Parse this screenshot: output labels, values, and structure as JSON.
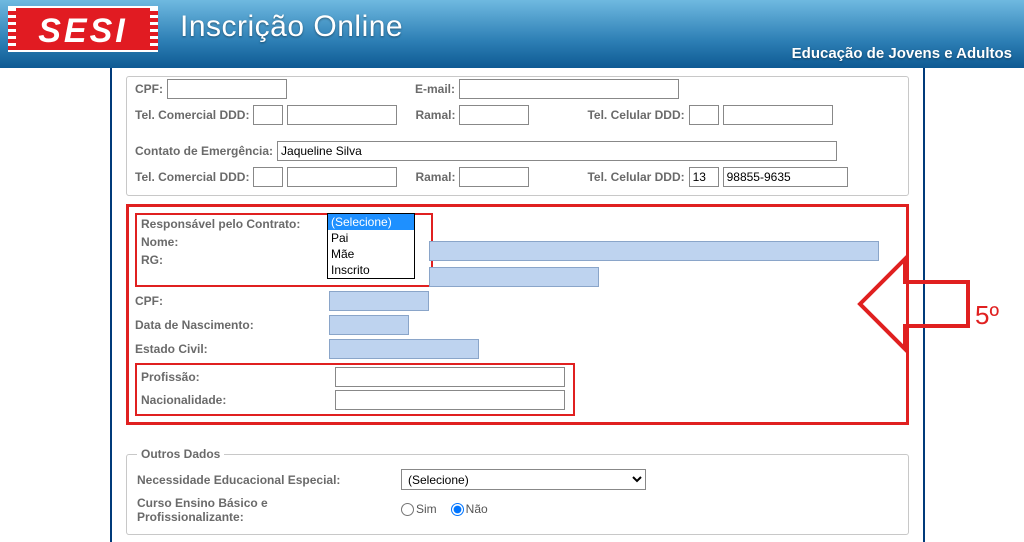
{
  "header": {
    "logo_text": "SESI",
    "title": "Inscrição Online",
    "subtitle": "Educação de Jovens e Adultos"
  },
  "top": {
    "cpf_label": "CPF:",
    "email_label": "E-mail:",
    "tel_com_ddd_label": "Tel. Comercial DDD:",
    "ramal_label": "Ramal:",
    "tel_cel_ddd_label": "Tel. Celular DDD:"
  },
  "emergencia": {
    "contato_label": "Contato de Emergência:",
    "contato_value": "Jaqueline Silva",
    "tel_com_ddd_label": "Tel. Comercial DDD:",
    "ramal_label": "Ramal:",
    "tel_cel_ddd_label": "Tel. Celular DDD:",
    "cel_ddd_value": "13",
    "cel_num_value": "98855-9635"
  },
  "responsavel": {
    "resp_label": "Responsável pelo Contrato:",
    "nome_label": "Nome:",
    "rg_label": "RG:",
    "cpf_label": "CPF:",
    "datanasc_label": "Data de Nascimento:",
    "estcivil_label": "Estado Civil:",
    "profissao_label": "Profissão:",
    "nacionalidade_label": "Nacionalidade:",
    "dropdown": {
      "opt0": "(Selecione)",
      "opt1": "Pai",
      "opt2": "Mãe",
      "opt3": "Inscrito"
    }
  },
  "outros": {
    "legend": "Outros Dados",
    "necessidade_label": "Necessidade Educacional Especial:",
    "necessidade_sel": "(Selecione)",
    "curso_label_l1": "Curso Ensino Básico e",
    "curso_label_l2": "Profissionalizante:",
    "sim_label": "Sim",
    "nao_label": "Não"
  },
  "annotation": {
    "step": "5º"
  }
}
